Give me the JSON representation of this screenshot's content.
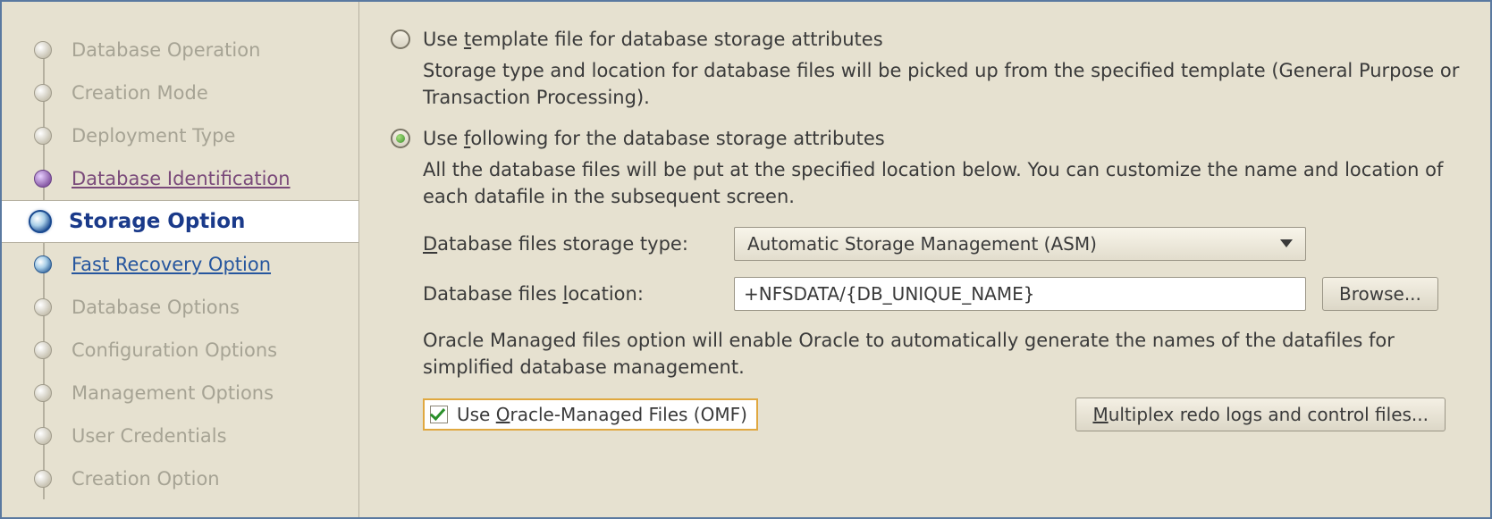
{
  "sidebar": {
    "items": [
      {
        "label": "Database Operation",
        "state": "disabled"
      },
      {
        "label": "Creation Mode",
        "state": "disabled"
      },
      {
        "label": "Deployment Type",
        "state": "disabled"
      },
      {
        "label": "Database Identification",
        "state": "visited"
      },
      {
        "label": "Storage Option",
        "state": "current"
      },
      {
        "label": "Fast Recovery Option",
        "state": "future"
      },
      {
        "label": "Database Options",
        "state": "disabled"
      },
      {
        "label": "Configuration Options",
        "state": "disabled"
      },
      {
        "label": "Management Options",
        "state": "disabled"
      },
      {
        "label": "User Credentials",
        "state": "disabled"
      },
      {
        "label": "Creation Option",
        "state": "disabled"
      }
    ]
  },
  "option1": {
    "label_pre": "Use ",
    "label_m": "t",
    "label_post": "emplate file for database storage attributes",
    "selected": false,
    "description": "Storage type and location for database files will be picked up from the specified template (General Purpose or Transaction Processing)."
  },
  "option2": {
    "label_pre": "Use ",
    "label_m": "f",
    "label_post": "ollowing for the database storage attributes",
    "selected": true,
    "description": "All the database files will be put at the specified location below. You can customize the name and location of each datafile in the subsequent screen."
  },
  "form": {
    "storage_type_label_pre": "",
    "storage_type_label_m": "D",
    "storage_type_label_post": "atabase files storage type:",
    "storage_type_value": "Automatic Storage Management (ASM)",
    "location_label_pre": "Database files ",
    "location_label_m": "l",
    "location_label_post": "ocation:",
    "location_value": "+NFSDATA/{DB_UNIQUE_NAME}",
    "browse_label": "Browse...",
    "omf_description": "Oracle Managed files option will enable Oracle to automatically generate the names of the datafiles for simplified database management.",
    "omf_checkbox_pre": "Use ",
    "omf_checkbox_m": "O",
    "omf_checkbox_post": "racle-Managed Files (OMF)",
    "omf_checked": true,
    "multiplex_pre": "",
    "multiplex_m": "M",
    "multiplex_post": "ultiplex redo logs and control files..."
  }
}
